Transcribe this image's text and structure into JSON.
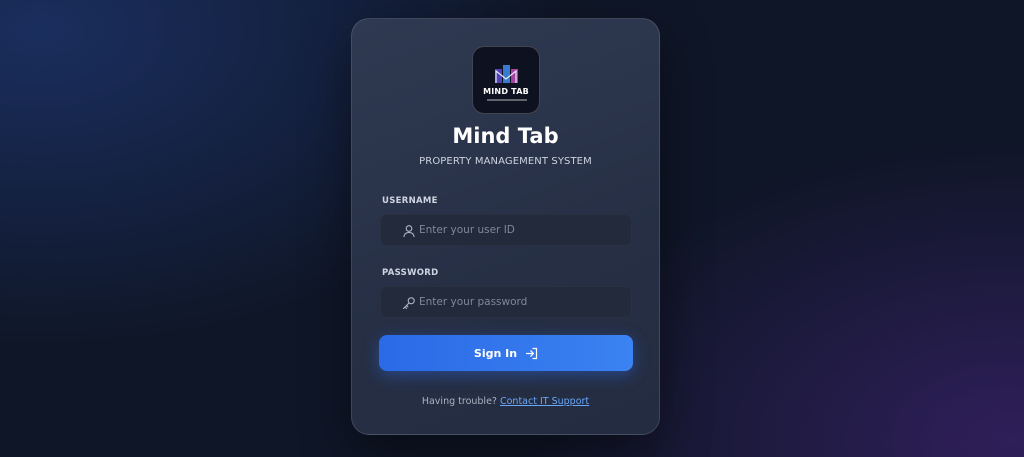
{
  "brand": {
    "logo_text": "MIND TAB",
    "name": "Mind Tab",
    "tagline": "PROPERTY MANAGEMENT SYSTEM"
  },
  "form": {
    "username": {
      "label": "USERNAME",
      "placeholder": "Enter your user ID",
      "value": "",
      "icon": "user-icon"
    },
    "password": {
      "label": "PASSWORD",
      "placeholder": "Enter your password",
      "value": "",
      "icon": "key-icon"
    },
    "submit_label": "Sign In",
    "submit_icon": "sign-in-arrow-icon"
  },
  "footer": {
    "help_text": "Having trouble?",
    "help_link": "Contact IT Support"
  },
  "colors": {
    "accent": "#3b82f2",
    "link": "#6aa6f8",
    "card": "#2a3349",
    "background": "#0f1627"
  }
}
